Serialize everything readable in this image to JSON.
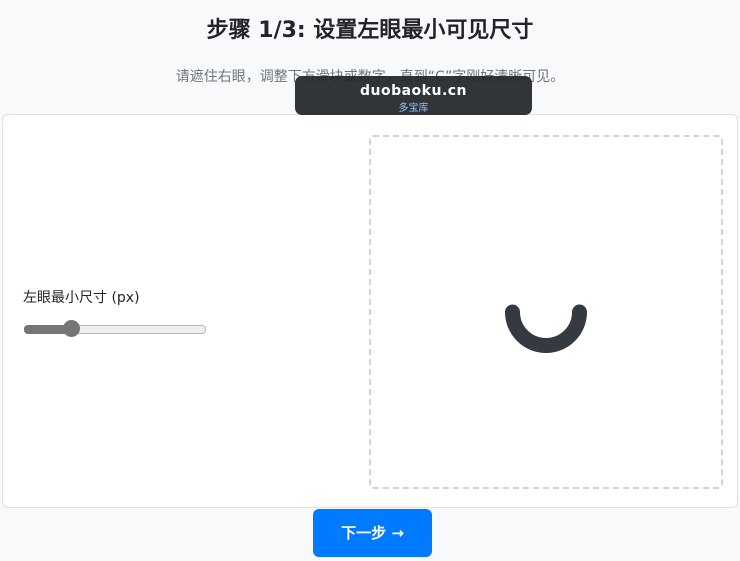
{
  "header": {
    "title": "步骤 1/3: 设置左眼最小可见尺寸",
    "instruction": "请遮住右眼，调整下方滑块或数字，直到“C”字刚好清晰可见。"
  },
  "control": {
    "label": "左眼最小尺寸 (px)",
    "slider_fraction": 0.26
  },
  "preview": {
    "symbol": "C",
    "symbol_orientation": "opening-up",
    "symbol_color": "#343a40"
  },
  "footer": {
    "next_button_label": "下一步 →"
  },
  "watermark": {
    "site": "duobaoku.cn",
    "name": "多宝库"
  },
  "colors": {
    "accent": "#007bff",
    "background": "#f8f9fa",
    "card": "#ffffff",
    "symbol": "#343a40"
  }
}
